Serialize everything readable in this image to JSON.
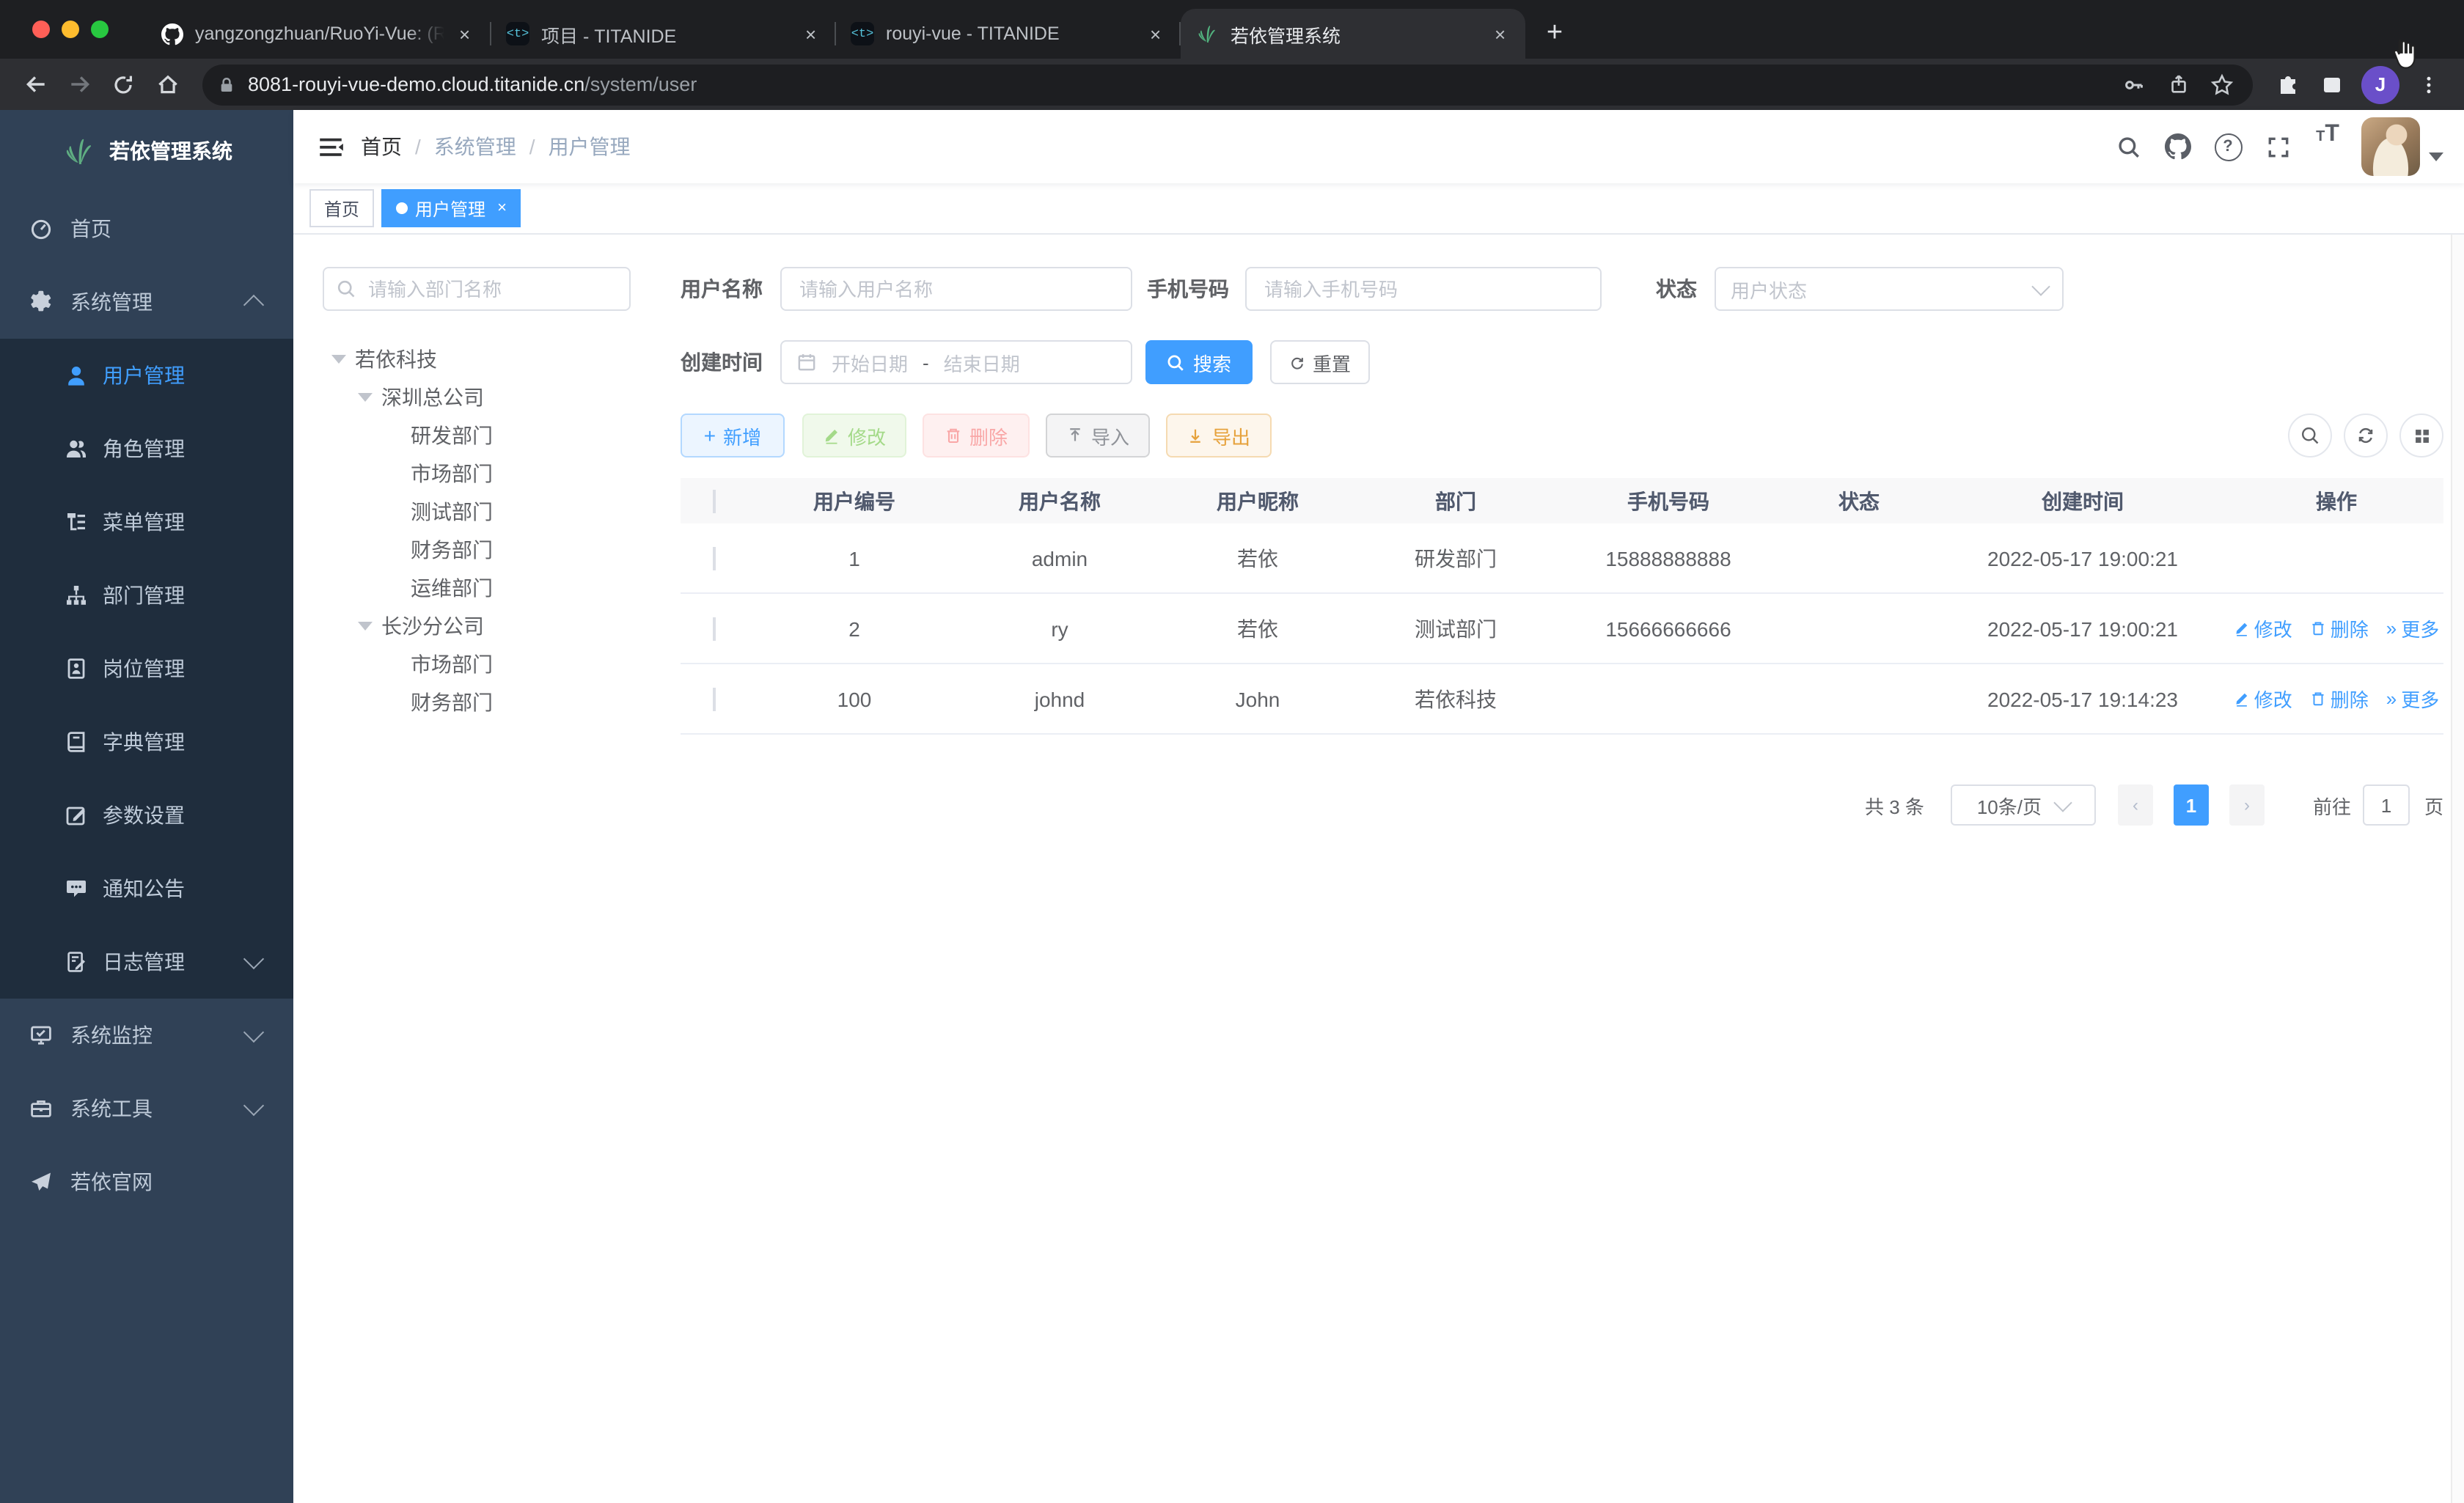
{
  "colors": {
    "accent": "#409eff",
    "sidebar_bg": "#304156",
    "submenu_bg": "#1f2d3d",
    "success": "#67c23a",
    "danger": "#f56c6c",
    "warning": "#e6a23c",
    "info": "#909399",
    "chrome_dark": "#1e1f22",
    "tag_active": "#409eff"
  },
  "browser": {
    "tabs": [
      {
        "title": "yangzongzhuan/RuoYi-Vue: (Ru",
        "icon": "github-icon"
      },
      {
        "title": "项目 - TITANIDE",
        "icon": "titanide-icon"
      },
      {
        "title": "rouyi-vue - TITANIDE",
        "icon": "titanide-icon"
      },
      {
        "title": "若依管理系统",
        "icon": "ruoyi-logo-icon"
      }
    ],
    "titanide_glyph": "<t>",
    "url_host": "8081-rouyi-vue-demo.cloud.titanide.cn",
    "url_path": "/system/user",
    "profile_letter": "J"
  },
  "sidebar": {
    "logo_title": "若依管理系统",
    "items": [
      {
        "label": "首页"
      },
      {
        "label": "系统管理"
      },
      {
        "label": "用户管理"
      },
      {
        "label": "角色管理"
      },
      {
        "label": "菜单管理"
      },
      {
        "label": "部门管理"
      },
      {
        "label": "岗位管理"
      },
      {
        "label": "字典管理"
      },
      {
        "label": "参数设置"
      },
      {
        "label": "通知公告"
      },
      {
        "label": "日志管理"
      },
      {
        "label": "系统监控"
      },
      {
        "label": "系统工具"
      },
      {
        "label": "若依官网"
      }
    ]
  },
  "navbar": {
    "breadcrumb": {
      "home": "首页",
      "section": "系统管理",
      "page": "用户管理"
    }
  },
  "tags": {
    "home": "首页",
    "active": "用户管理"
  },
  "tree": {
    "search_placeholder": "请输入部门名称",
    "nodes": [
      {
        "label": "若依科技"
      },
      {
        "label": "深圳总公司"
      },
      {
        "label": "研发部门"
      },
      {
        "label": "市场部门"
      },
      {
        "label": "测试部门"
      },
      {
        "label": "财务部门"
      },
      {
        "label": "运维部门"
      },
      {
        "label": "长沙分公司"
      },
      {
        "label": "市场部门"
      },
      {
        "label": "财务部门"
      }
    ]
  },
  "filters": {
    "username_label": "用户名称",
    "username_placeholder": "请输入用户名称",
    "phone_label": "手机号码",
    "phone_placeholder": "请输入手机号码",
    "status_label": "状态",
    "status_placeholder": "用户状态",
    "date_label": "创建时间",
    "date_start": "开始日期",
    "date_separator": "-",
    "date_end": "结束日期",
    "search_label": "搜索",
    "reset_label": "重置"
  },
  "toolbar": {
    "add_label": "新增",
    "edit_label": "修改",
    "delete_label": "删除",
    "import_label": "导入",
    "export_label": "导出"
  },
  "table": {
    "columns": [
      "用户编号",
      "用户名称",
      "用户昵称",
      "部门",
      "手机号码",
      "状态",
      "创建时间",
      "操作"
    ],
    "op_labels": {
      "edit": "修改",
      "delete": "删除",
      "more": "更多"
    },
    "rows": [
      {
        "id": "1",
        "username": "admin",
        "nickname": "若依",
        "dept": "研发部门",
        "phone": "15888888888",
        "created": "2022-05-17 19:00:21",
        "status": "on"
      },
      {
        "id": "2",
        "username": "ry",
        "nickname": "若依",
        "dept": "测试部门",
        "phone": "15666666666",
        "created": "2022-05-17 19:00:21",
        "status": "on"
      },
      {
        "id": "100",
        "username": "johnd",
        "nickname": "John",
        "dept": "若依科技",
        "phone": "",
        "created": "2022-05-17 19:14:23",
        "status": "on"
      }
    ]
  },
  "pagination": {
    "total": "共 3 条",
    "page_size": "10条/页",
    "current_page": "1",
    "goto_label": "前往",
    "goto_value": "1",
    "unit_label": "页"
  }
}
